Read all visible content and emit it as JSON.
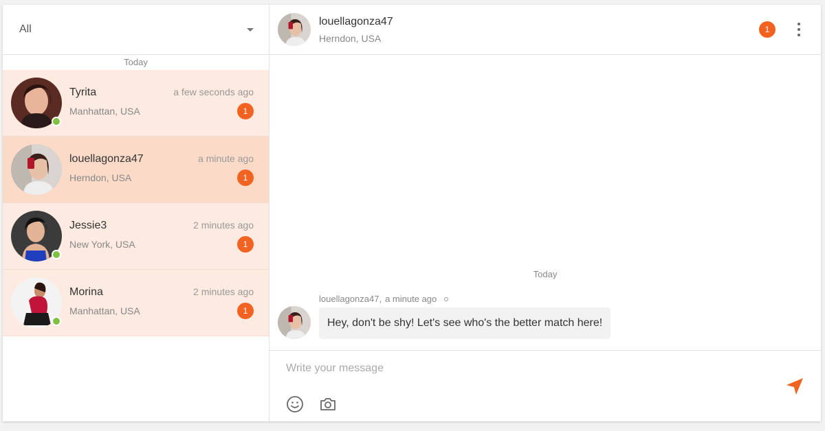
{
  "filter": {
    "value": "All"
  },
  "sidebar": {
    "day_label": "Today",
    "conversations": [
      {
        "name": "Tyrita",
        "location": "Manhattan, USA",
        "time": "a few seconds ago",
        "unread": "1",
        "online": true
      },
      {
        "name": "louellagonza47",
        "location": "Herndon, USA",
        "time": "a minute ago",
        "unread": "1",
        "online": false
      },
      {
        "name": "Jessie3",
        "location": "New York, USA",
        "time": "2 minutes ago",
        "unread": "1",
        "online": true
      },
      {
        "name": "Morina",
        "location": "Manhattan, USA",
        "time": "2 minutes ago",
        "unread": "1",
        "online": true
      }
    ]
  },
  "chat": {
    "name": "louellagonza47",
    "location": "Herndon, USA",
    "unread": "1",
    "day_label": "Today",
    "message": {
      "sender": "louellagonza47,",
      "time": "a minute ago",
      "text": "Hey, don't be shy! Let's see who's the better match here!"
    }
  },
  "composer": {
    "placeholder": "Write your message"
  },
  "colors": {
    "accent": "#f26322",
    "online": "#7cc142",
    "row_bg": "#fdeae0",
    "row_active_bg": "#fbdac8"
  },
  "icons": {
    "emoji": "smiley-icon",
    "camera": "camera-icon",
    "send": "send-icon",
    "menu": "more-vertical-icon",
    "dropdown": "caret-down-icon"
  }
}
